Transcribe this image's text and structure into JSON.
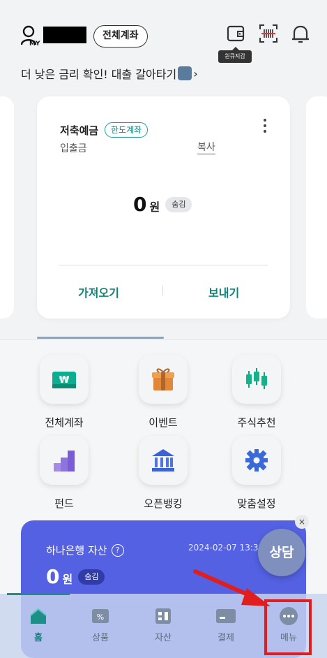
{
  "header": {
    "my_label": "MY",
    "all_accounts_button": "전체계좌",
    "wallet_tooltip": "원큐지갑",
    "promo_text": "더 낮은 금리 확인! 대출 갈아타기",
    "promo_chevron": "›"
  },
  "account_card": {
    "title": "저축예금",
    "badge": "한도계좌",
    "subtitle": "입출금",
    "copy_label": "복사",
    "amount": "0",
    "unit": "원",
    "hide_label": "숨김",
    "fetch_button": "가져오기",
    "send_button": "보내기"
  },
  "quick_menu": [
    {
      "label": "전체계좌",
      "icon": "won-card-icon"
    },
    {
      "label": "이벤트",
      "icon": "gift-icon"
    },
    {
      "label": "주식추천",
      "icon": "candlestick-icon"
    },
    {
      "label": "펀드",
      "icon": "bar-chart-icon"
    },
    {
      "label": "오픈뱅킹",
      "icon": "bank-icon"
    },
    {
      "label": "맞춤설정",
      "icon": "gear-icon"
    }
  ],
  "asset_card": {
    "title": "하나은행 자산",
    "help": "?",
    "date": "2024-02-07 13:38",
    "amount": "0",
    "unit": "원",
    "hide_label": "숨김",
    "close": "×"
  },
  "consult_button": "상담",
  "tabbar": [
    {
      "label": "홈",
      "icon": "home-icon",
      "active": true
    },
    {
      "label": "상품",
      "icon": "product-icon",
      "active": false
    },
    {
      "label": "자산",
      "icon": "asset-icon",
      "active": false
    },
    {
      "label": "결제",
      "icon": "card-icon",
      "active": false
    },
    {
      "label": "메뉴",
      "icon": "more-icon",
      "active": false
    }
  ],
  "colors": {
    "accent": "#0e8178",
    "asset_card": "#5361e2",
    "highlight": "#e11d1d"
  }
}
